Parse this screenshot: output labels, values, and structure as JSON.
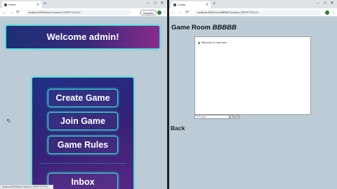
{
  "left_window": {
    "tab_title": "Home",
    "url": "localhost:5000/home?session=XR5FF7XXXXX",
    "incognito_label": "Incognito",
    "welcome_text": "Welcome admin!",
    "menu": {
      "create_game": "Create Game",
      "join_game": "Join Game",
      "game_rules": "Game Rules",
      "inbox": "Inbox"
    },
    "status_bar": "localhost:5000/inbox?session=XR5FF7XXXXX"
  },
  "right_window": {
    "tab_title": "Lobby",
    "url": "localhost:5000/room/BBBBB?session=XR5FF7XXXXX",
    "room_label": "Game Room",
    "room_code": "BBBBB",
    "chat_message": "Welcome to chat room",
    "chat_placeholder": "Message",
    "send_label": "Send",
    "back_label": "Back"
  },
  "colors": {
    "page_bg": "#bccbd6",
    "neon_border": "#37e0d5",
    "panel_start": "#1f2f85",
    "panel_end": "#8a2a8c"
  }
}
